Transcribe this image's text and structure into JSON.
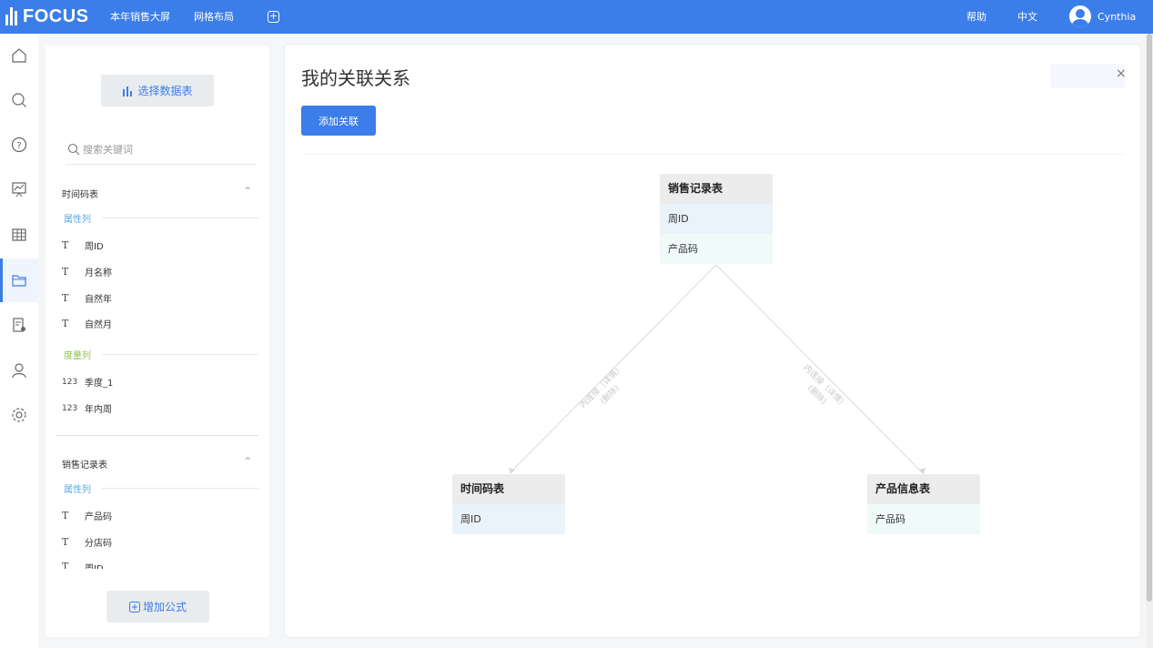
{
  "app": {
    "logo_text": "FOCUS",
    "user": "Cynthia"
  },
  "topbar": {
    "nav": [
      "本年销售大屏",
      "网格布局"
    ],
    "add_icon": "plus-square-icon",
    "help": "帮助",
    "language": "中文"
  },
  "sidebar": {
    "icons": [
      "home-icon",
      "search-icon",
      "help-icon",
      "dashboard-icon",
      "table-icon",
      "folder-icon",
      "report-settings-icon",
      "user-icon",
      "gear-icon"
    ],
    "active": "folder-icon"
  },
  "data_panel": {
    "choose_table_label": "选择数据表",
    "search_placeholder": "搜索关键词",
    "tables": [
      {
        "name": "时间码表",
        "attr_label": "属性列",
        "attr_fields": [
          "周ID",
          "月名称",
          "自然年",
          "自然月"
        ],
        "measure_label": "度量列",
        "measure_fields": [
          "季度_1",
          "年内周"
        ]
      },
      {
        "name": "销售记录表",
        "attr_label": "属性列",
        "attr_fields": [
          "产品码",
          "分店码",
          "周ID"
        ]
      }
    ],
    "measure_type_glyph": "123",
    "add_formula_label": "增加公式"
  },
  "main": {
    "title": "我的关联关系",
    "add_button": "添加关联",
    "close": "×",
    "diagram": {
      "center": {
        "name": "销售记录表",
        "fields": [
          "周ID",
          "产品码"
        ]
      },
      "left": {
        "name": "时间码表",
        "fields": [
          "周ID"
        ]
      },
      "right": {
        "name": "产品信息表",
        "fields": [
          "产品码"
        ]
      },
      "edge_label_1": "内连接（详情）",
      "edge_label_2": "(删除)"
    }
  },
  "colors": {
    "primary": "#3b7de9",
    "measure": "#8bc34a",
    "attribute": "#5aa9e6"
  }
}
